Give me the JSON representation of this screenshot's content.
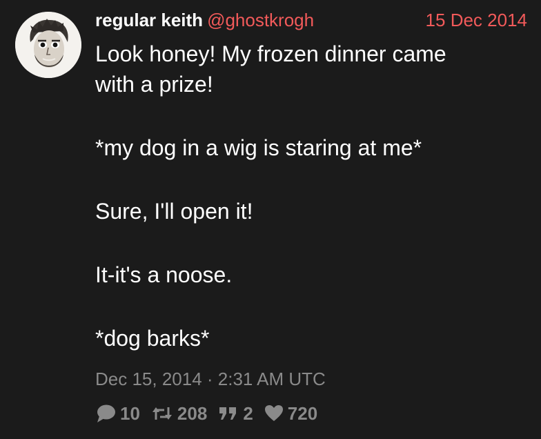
{
  "tweet": {
    "display_name": "regular keith",
    "handle": "@ghostkrogh",
    "date": "15 Dec 2014",
    "paragraphs": [
      "Look honey! My frozen dinner came\nwith a prize!",
      "*my dog in a wig is staring at me*",
      "Sure, I'll open it!",
      "It-it's a noose.",
      "*dog barks*"
    ],
    "timestamp": "Dec 15, 2014 · 2:31 AM UTC"
  },
  "stats": {
    "replies": "10",
    "retweets": "208",
    "quotes": "2",
    "likes": "720"
  },
  "icons": {
    "reply": "speech-bubble-icon",
    "retweet": "retweet-arrows-icon",
    "quote": "quote-marks-icon",
    "like": "heart-icon"
  },
  "colors": {
    "background": "#1b1b1b",
    "accent": "#f25a5a",
    "muted": "#8a8a8a",
    "text": "#ffffff"
  }
}
